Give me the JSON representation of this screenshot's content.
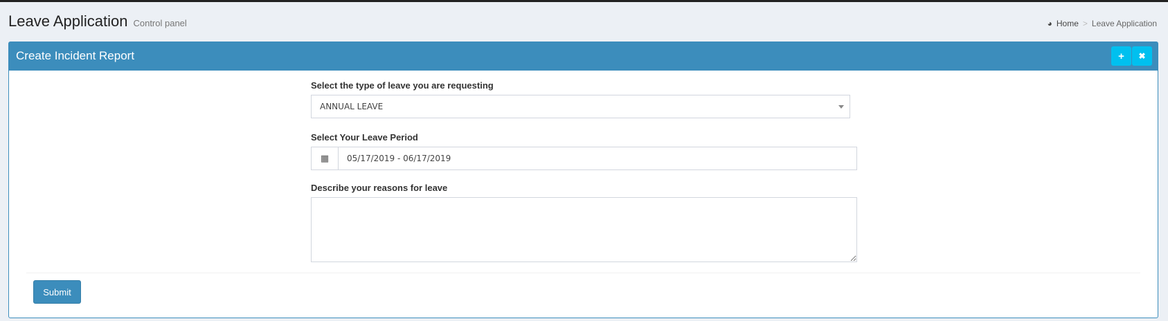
{
  "header": {
    "title": "Leave Application",
    "subtitle": "Control panel"
  },
  "breadcrumb": {
    "home": "Home",
    "separator": ">",
    "current": "Leave Application"
  },
  "box": {
    "title": "Create Incident Report",
    "expand_icon": "+",
    "close_icon": "✖"
  },
  "form": {
    "leave_type_label": "Select the type of leave you are requesting",
    "leave_type_value": "ANNUAL LEAVE",
    "period_label": "Select Your Leave Period",
    "period_value": "05/17/2019 - 06/17/2019",
    "reason_label": "Describe your reasons for leave",
    "reason_value": "",
    "submit_label": "Submit"
  },
  "colors": {
    "primary": "#3c8dbc",
    "info": "#00c0ef",
    "background": "#ecf0f5"
  }
}
